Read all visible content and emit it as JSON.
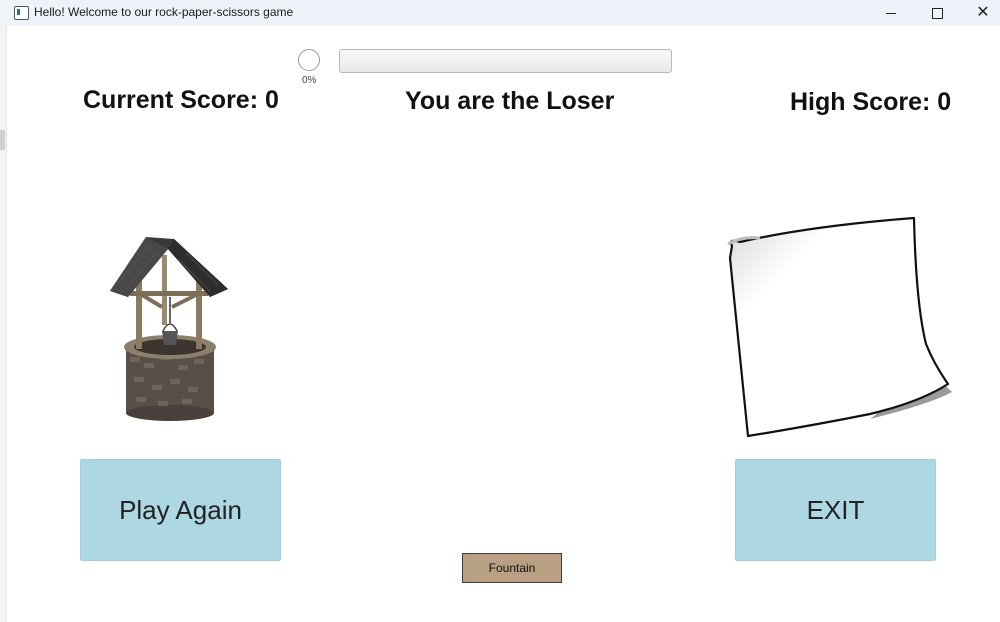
{
  "window": {
    "title": "Hello! Welcome to our rock-paper-scissors game"
  },
  "progress": {
    "label": "0%",
    "value_percent": 0
  },
  "scores": {
    "current": "Current Score: 0",
    "status": "You are the Loser",
    "high": "High Score: 0"
  },
  "choices": {
    "player_icon": "wishing-well-icon",
    "computer_icon": "paper-sheet-icon"
  },
  "buttons": {
    "play_again": "Play Again",
    "exit": "EXIT",
    "fountain": "Fountain"
  },
  "colors": {
    "button_bg": "#acd7e3",
    "fountain_bg": "#b9a083"
  }
}
